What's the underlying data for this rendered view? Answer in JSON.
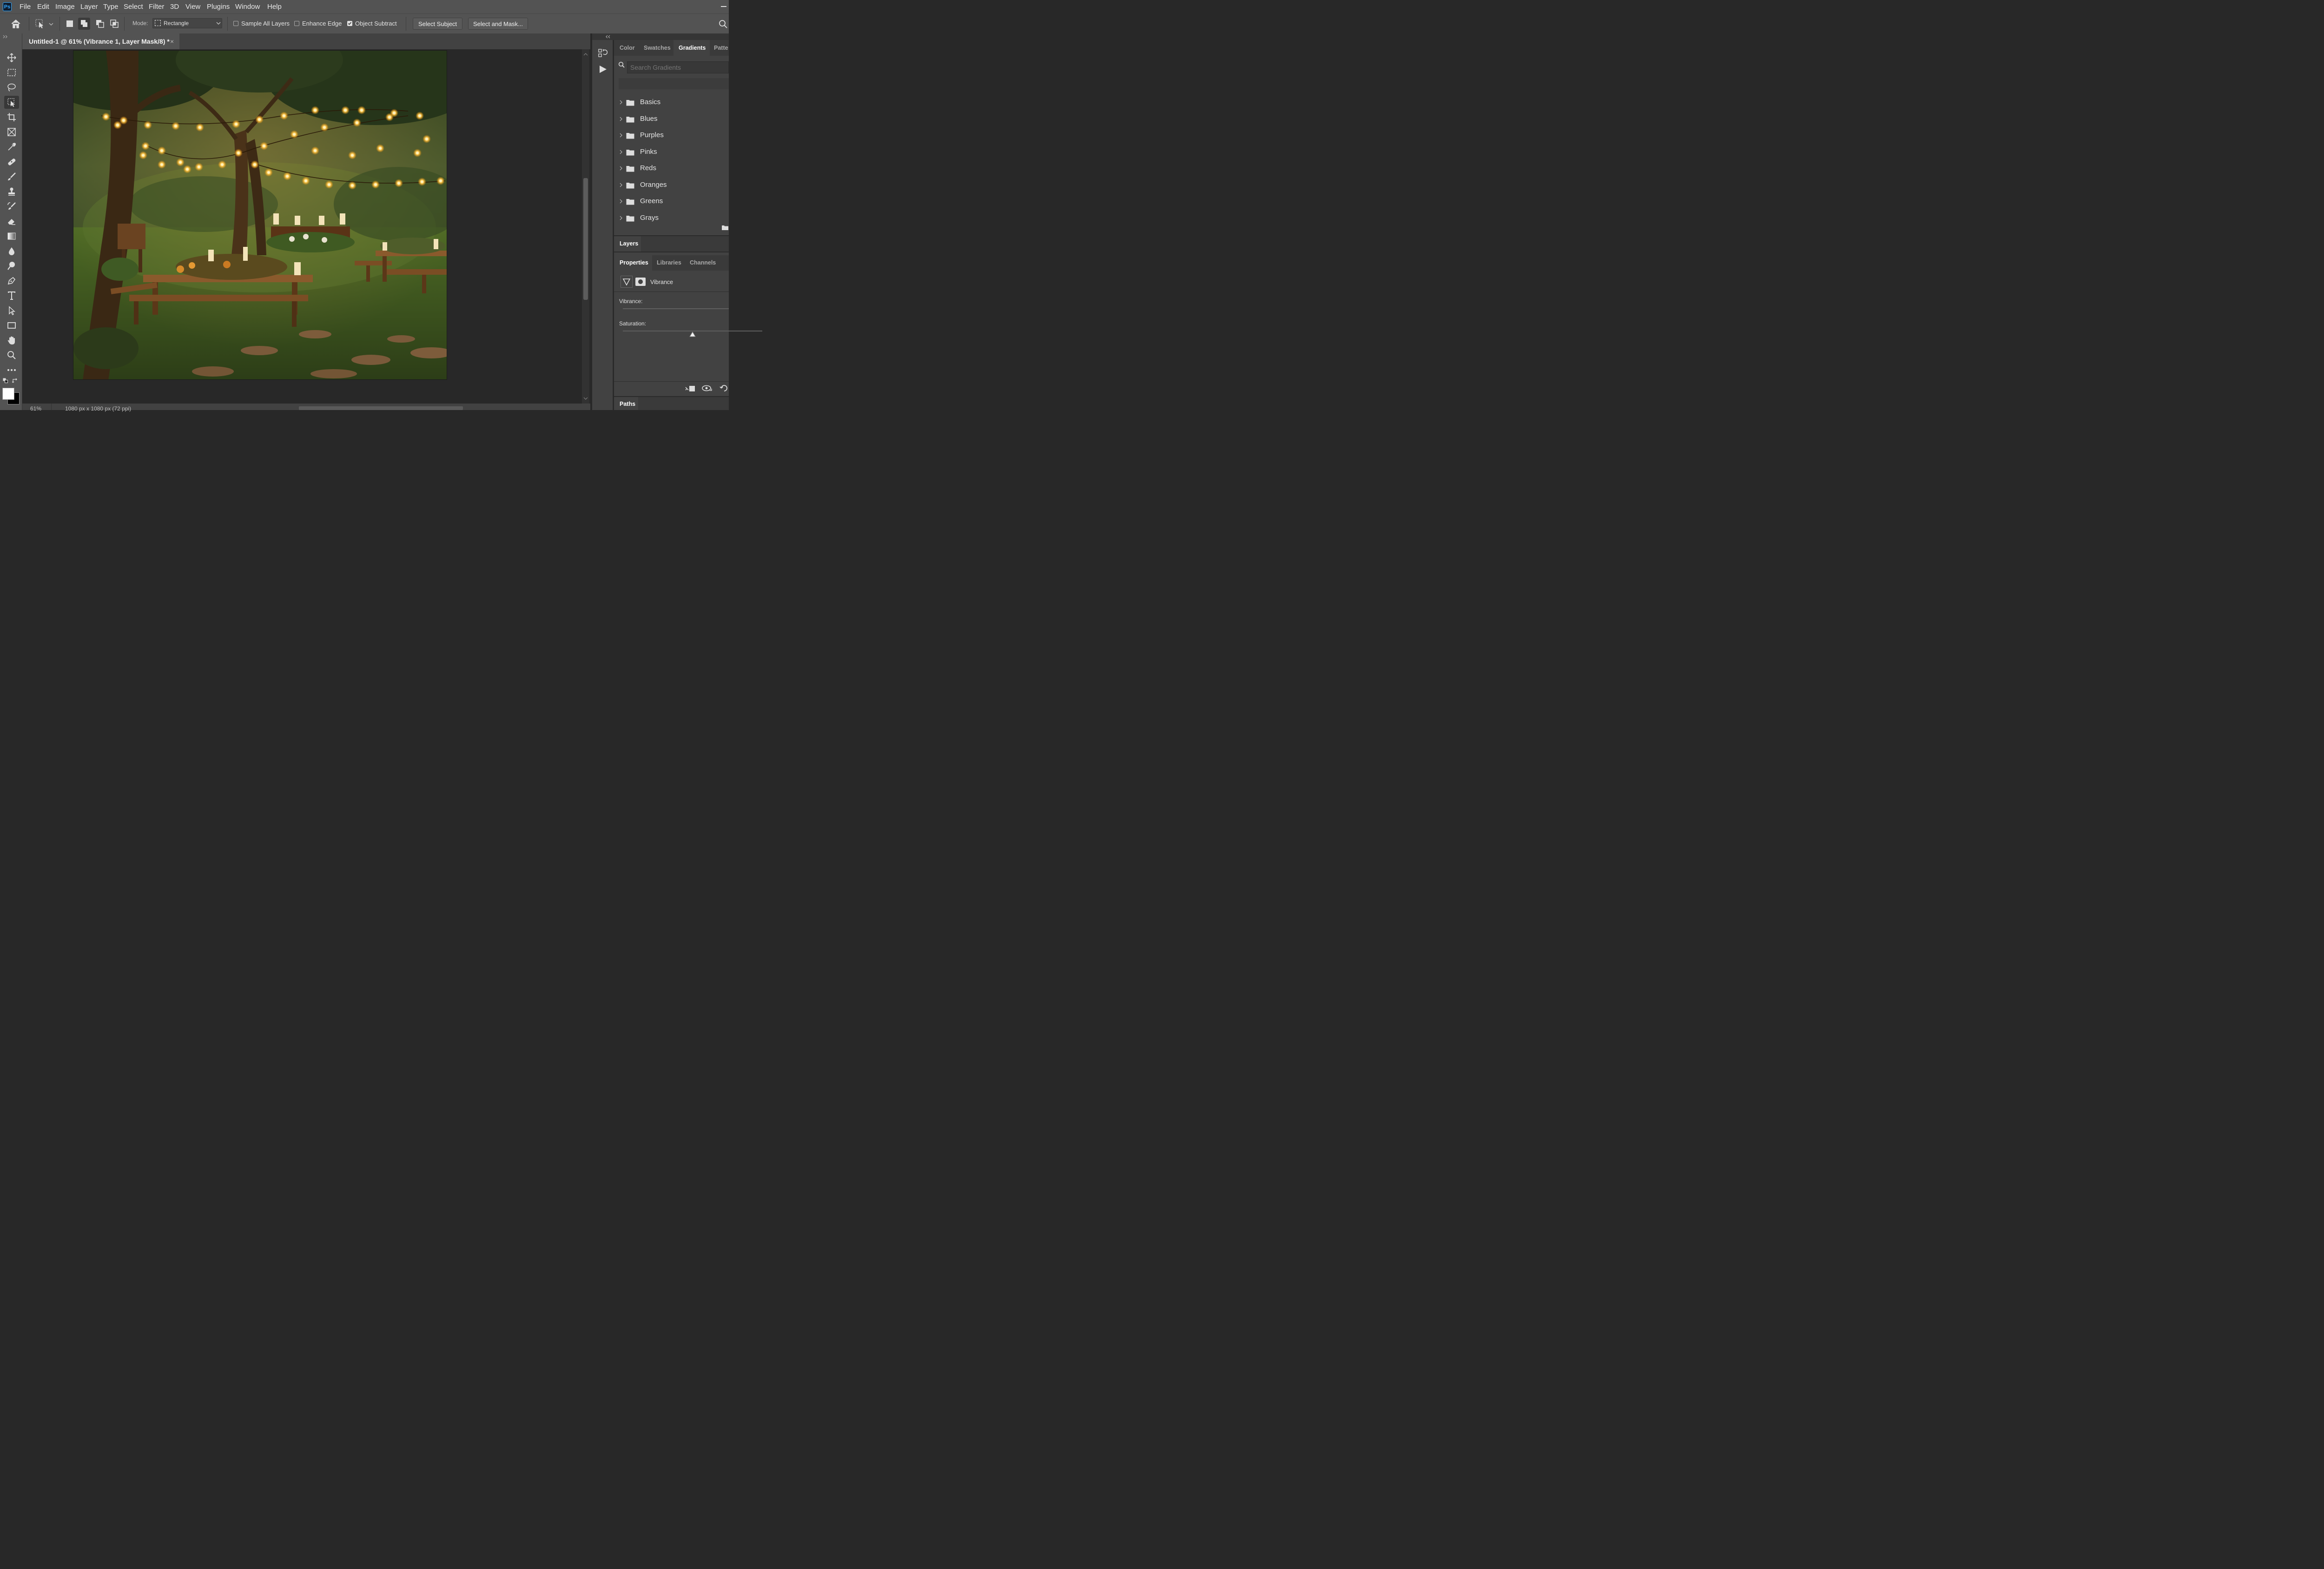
{
  "app": {
    "logo": "Ps"
  },
  "menu": [
    "File",
    "Edit",
    "Image",
    "Layer",
    "Type",
    "Select",
    "Filter",
    "3D",
    "View",
    "Plugins",
    "Window",
    "Help"
  ],
  "options": {
    "mode_label": "Mode:",
    "mode_value": "Rectangle",
    "sample_all_layers": {
      "label": "Sample All Layers",
      "checked": false
    },
    "enhance_edge": {
      "label": "Enhance Edge",
      "checked": false
    },
    "object_subtract": {
      "label": "Object Subtract",
      "checked": true
    },
    "select_subject": "Select Subject",
    "select_and_mask": "Select and Mask..."
  },
  "document": {
    "tab_title": "Untitled-1 @ 61% (Vibrance 1, Layer Mask/8) *",
    "close": "×",
    "zoom": "61%",
    "dimensions": "1080 px x 1080 px (72 ppi)"
  },
  "tools": [
    "move-tool",
    "marquee-tool",
    "lasso-tool",
    "object-selection-tool",
    "crop-tool",
    "frame-tool",
    "eyedropper-tool",
    "healing-brush-tool",
    "brush-tool",
    "clone-stamp-tool",
    "history-brush-tool",
    "eraser-tool",
    "gradient-tool",
    "blur-tool",
    "dodge-tool",
    "pen-tool",
    "type-tool",
    "path-selection-tool",
    "rectangle-tool",
    "hand-tool",
    "zoom-tool",
    "more-tools"
  ],
  "gradients_panel": {
    "tabs": [
      "Color",
      "Swatches",
      "Gradients",
      "Patte"
    ],
    "active_tab": "Gradients",
    "search_placeholder": "Search Gradients",
    "folders": [
      "Basics",
      "Blues",
      "Purples",
      "Pinks",
      "Reds",
      "Oranges",
      "Greens",
      "Grays"
    ]
  },
  "layers_panel": {
    "tab": "Layers"
  },
  "properties_panel": {
    "tabs": [
      "Properties",
      "Libraries",
      "Channels"
    ],
    "active_tab": "Properties",
    "adjustment_name": "Vibrance",
    "vibrance_label": "Vibrance:",
    "saturation_label": "Saturation:",
    "saturation_level": 0.5
  },
  "paths_panel": {
    "tab": "Paths"
  }
}
